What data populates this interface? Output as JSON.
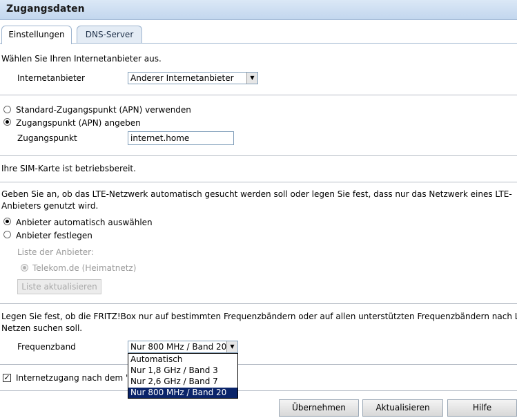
{
  "title": "Zugangsdaten",
  "tabs": [
    {
      "label": "Einstellungen"
    },
    {
      "label": "DNS-Server"
    }
  ],
  "provider": {
    "intro": "Wählen Sie Ihren Internetanbieter aus.",
    "label": "Internetanbieter",
    "selected": "Anderer Internetanbieter"
  },
  "apn": {
    "option_standard": "Standard-Zugangspunkt (APN) verwenden",
    "option_custom": "Zugangspunkt (APN) angeben",
    "label": "Zugangspunkt",
    "value": "internet.home"
  },
  "sim_status": "Ihre SIM-Karte ist betriebsbereit.",
  "lte": {
    "description_line1": "Geben Sie an, ob das LTE-Netzwerk automatisch gesucht werden soll oder legen Sie fest, dass nur das Netzwerk eines LTE-",
    "description_line2": "Anbieters genutzt wird.",
    "option_auto": "Anbieter automatisch auswählen",
    "option_fixed": "Anbieter festlegen",
    "list_label": "Liste der Anbieter:",
    "provider_item": "Telekom.de (Heimatnetz)",
    "refresh_label": "Liste aktualisieren"
  },
  "frequency": {
    "description_line1": "Legen Sie fest, ob die FRITZ!Box nur auf bestimmten Frequenzbändern oder auf allen unterstützten Frequenzbändern nach LTE-",
    "description_line2": "Netzen suchen soll.",
    "label": "Frequenzband",
    "selected": "Nur 800 MHz / Band 20",
    "options": [
      "Automatisch",
      "Nur 1,8 GHz / Band 3",
      "Nur 2,6 GHz / Band 7",
      "Nur 800 MHz / Band 20"
    ]
  },
  "internet_access": {
    "label": "Internetzugang nach dem \"Ü",
    "checked": true
  },
  "buttons": {
    "apply": "Übernehmen",
    "refresh": "Aktualisieren",
    "help": "Hilfe"
  }
}
